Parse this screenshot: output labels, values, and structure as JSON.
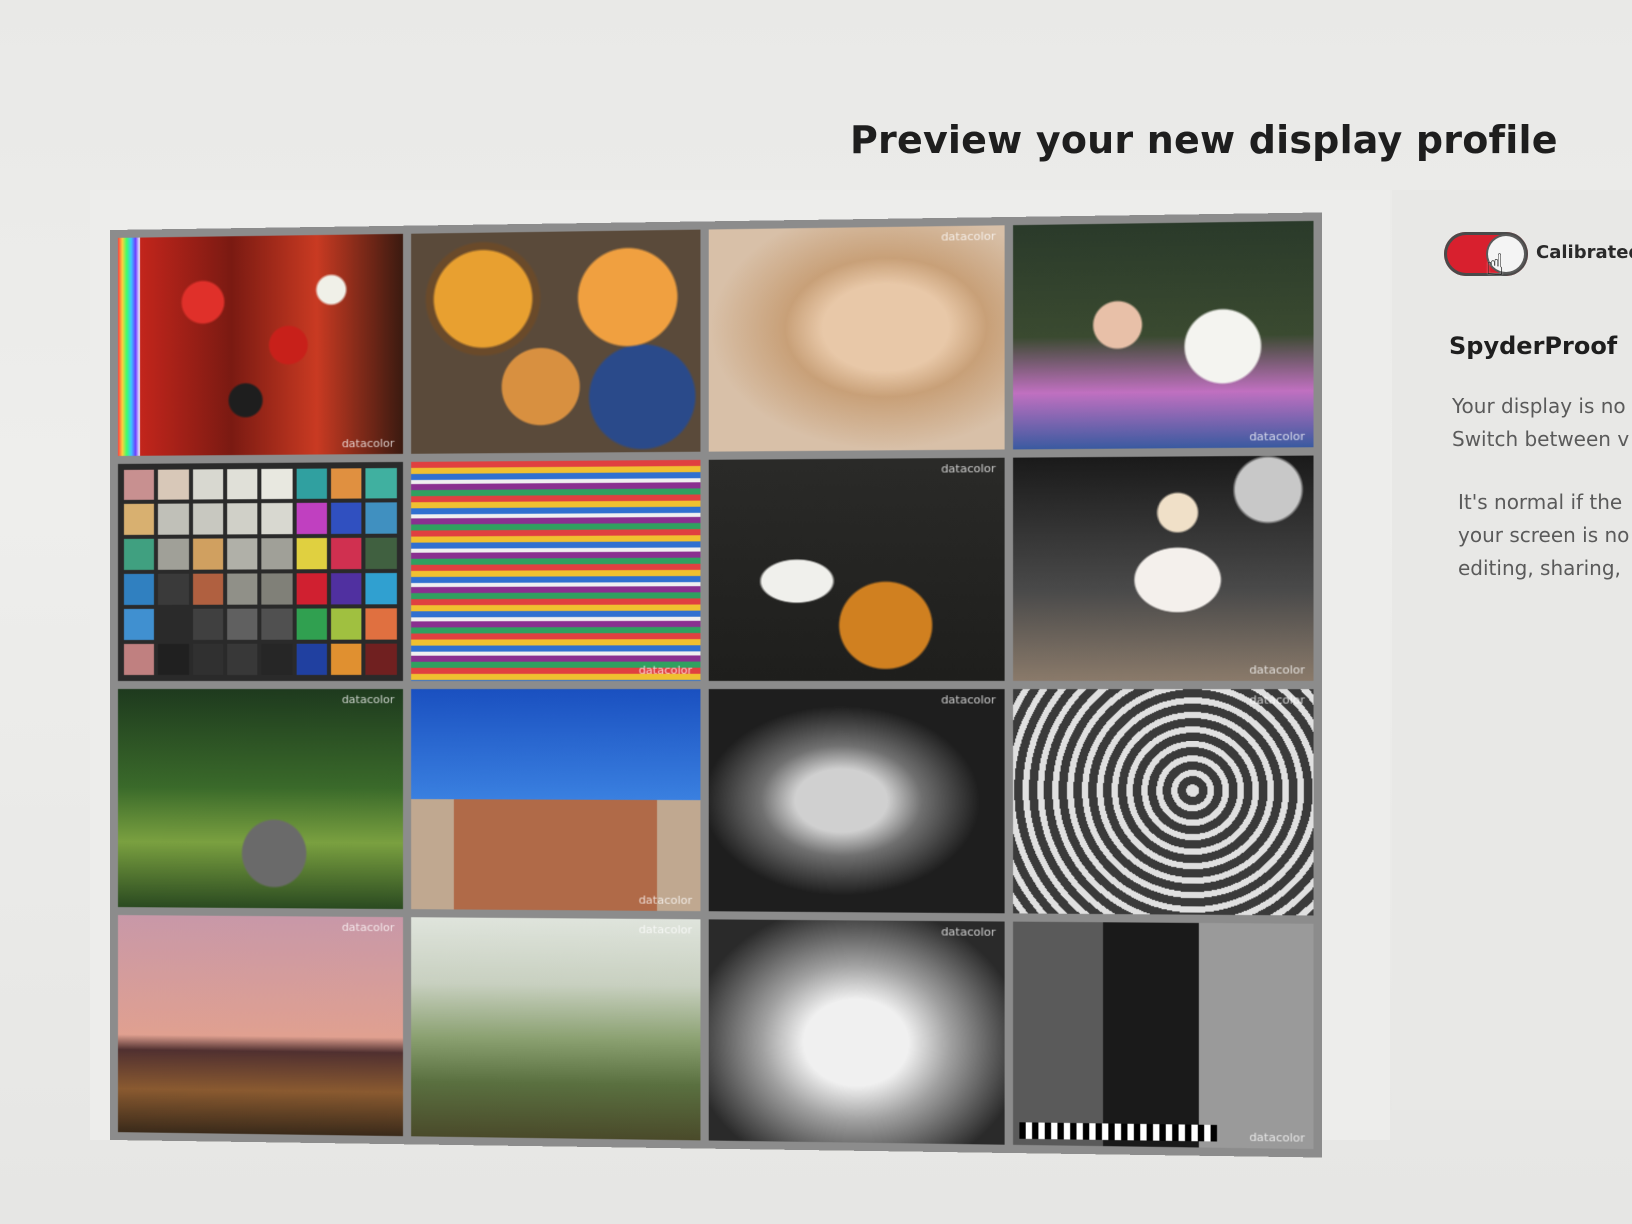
{
  "header": {
    "title": "Preview your new display profile"
  },
  "gallery": {
    "watermark": "datacolor",
    "tiles": [
      {
        "name": "peppers"
      },
      {
        "name": "plates"
      },
      {
        "name": "woman-portrait"
      },
      {
        "name": "girl-flowers"
      },
      {
        "name": "color-checker"
      },
      {
        "name": "fabric"
      },
      {
        "name": "cello-player"
      },
      {
        "name": "marilyn"
      },
      {
        "name": "garden"
      },
      {
        "name": "church"
      },
      {
        "name": "bw-portrait"
      },
      {
        "name": "spiral-stairs"
      },
      {
        "name": "sunset"
      },
      {
        "name": "tuscany"
      },
      {
        "name": "scooter"
      },
      {
        "name": "bw-test"
      }
    ]
  },
  "side_panel": {
    "toggle": {
      "label": "Calibrated",
      "state": "on",
      "color": "#d8202e"
    },
    "title": "SpyderProof",
    "paragraph1": [
      "Your display is no",
      "Switch between v"
    ],
    "paragraph2": [
      "It's normal if the",
      "your screen is no",
      "editing, sharing,"
    ]
  }
}
